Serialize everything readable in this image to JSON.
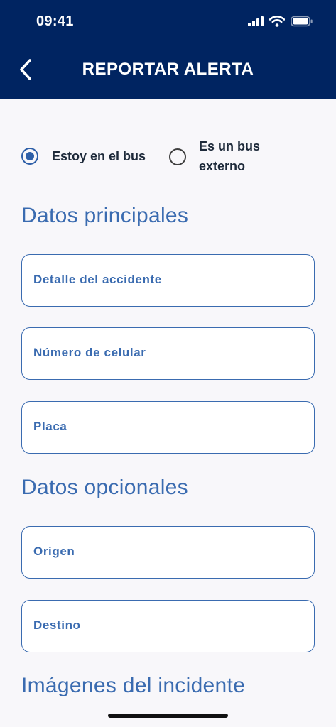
{
  "status_bar": {
    "time": "09:41"
  },
  "header": {
    "title": "REPORTAR ALERTA",
    "background_color": "#002461"
  },
  "location_options": [
    {
      "label": "Estoy en el bus",
      "selected": true
    },
    {
      "label_line1": "Es un bus",
      "label_line2": "externo",
      "selected": false
    }
  ],
  "sections": {
    "principal": "Datos principales",
    "optional": "Datos opcionales",
    "images": "Imágenes del incidente"
  },
  "fields": {
    "detail": "Detalle del accidente",
    "phone": "Número de celular",
    "plate": "Placa",
    "origin": "Origen",
    "destination": "Destino"
  },
  "colors": {
    "accent": "#3a6bb0",
    "radio_selected": "#2e5fa8"
  }
}
